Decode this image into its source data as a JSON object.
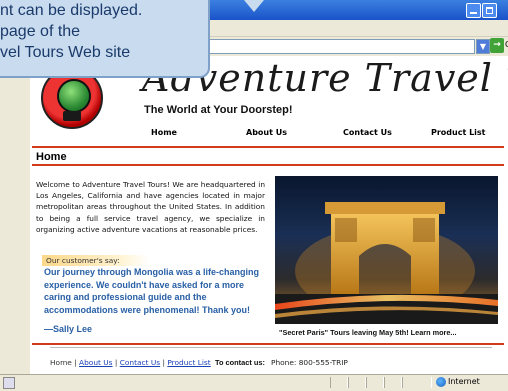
{
  "callout": {
    "lines": [
      "nt can be displayed.",
      "page of the",
      "vel Tours Web site"
    ]
  },
  "browser": {
    "go_label": "G",
    "address_arrow": "▼",
    "go_arrow": "→"
  },
  "site": {
    "brand": "Adventure Travel Tours",
    "tagline": "The World at Your Doorstep!",
    "nav": [
      "Home",
      "About Us",
      "Contact Us",
      "Product List"
    ],
    "page_title": "Home",
    "intro": "Welcome to Adventure Travel Tours! We are headquartered in Los Angeles, California and have agencies located in major metropolitan areas throughout the United States. In addition to being a full service travel agency, we specialize in organizing active adventure vacations at reasonable prices.",
    "customer_label": "Our customer's say:",
    "quote": "Our journey through Mongolia was a life-changing experience. We couldn't have asked for a more caring and professional guide and the accommodations were phenomenal! Thank you!",
    "quote_author": "—Sally Lee",
    "photo_caption": "\"Secret Paris\"  Tours leaving May 5th! Learn more...",
    "footer": {
      "home": "Home",
      "sep": "|",
      "about": "About Us",
      "contact": "Contact Us",
      "product": "Product List",
      "contact_label": "To contact us:",
      "phone": "Phone: 800-555-TRIP"
    }
  },
  "status": {
    "zone": "Internet"
  },
  "colors": {
    "accent_red": "#d23a1a",
    "nav_dot": "#f0c422",
    "quote_blue": "#2960a6",
    "link_blue": "#1a3fb7"
  }
}
